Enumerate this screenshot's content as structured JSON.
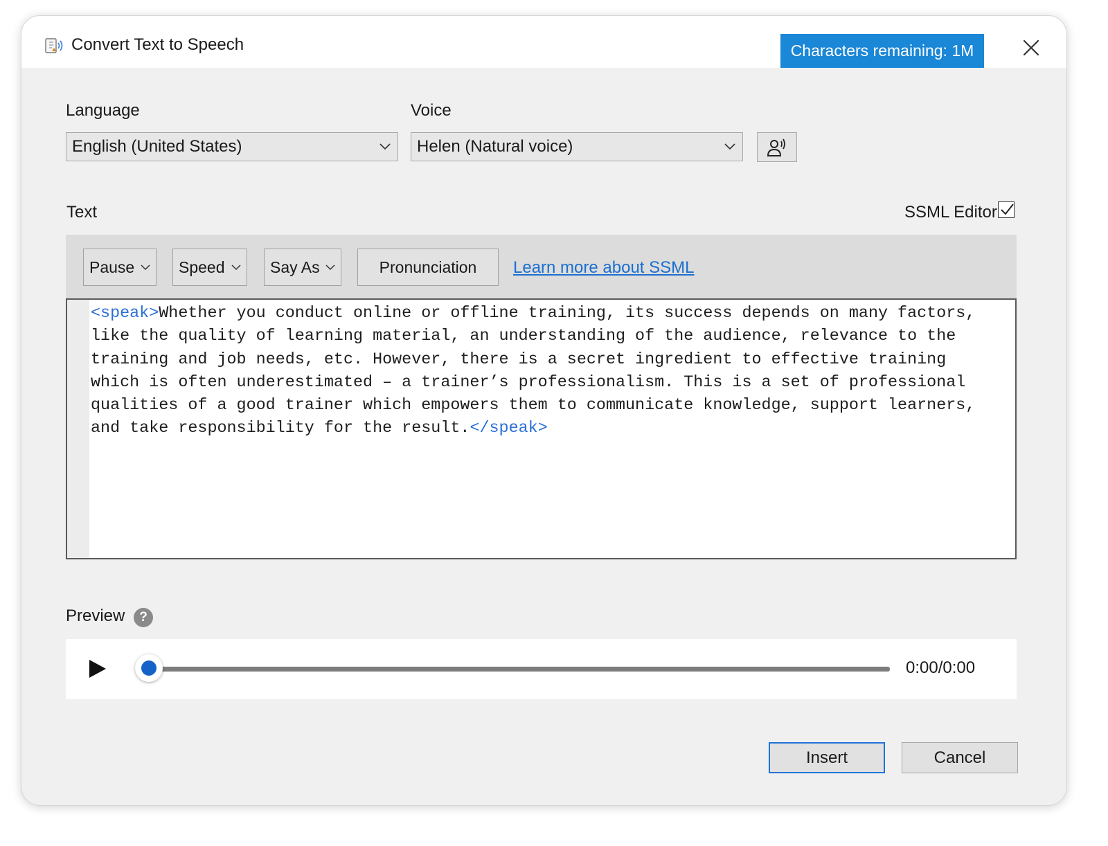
{
  "window": {
    "title": "Convert Text to Speech",
    "characters_remaining": "Characters remaining: 1M",
    "app_icon": "text-to-speech-icon",
    "close_icon": "close-icon"
  },
  "language": {
    "label": "Language",
    "selected": "English (United States)"
  },
  "voice": {
    "label": "Voice",
    "selected": "Helen (Natural voice)",
    "settings_icon": "voice-settings-icon"
  },
  "text_section": {
    "label": "Text",
    "ssml_editor_label": "SSML Editor",
    "ssml_editor_checked": true
  },
  "toolbar": {
    "pause": "Pause",
    "speed": "Speed",
    "say_as": "Say As",
    "pronunciation": "Pronunciation",
    "learn_more": "Learn more about SSML"
  },
  "editor": {
    "open_tag": "<speak>",
    "body": "Whether you conduct online or offline training, its success depends on many factors, like the quality of learning material, an understanding of the audience, relevance to the training and job needs, etc. However, there is a secret ingredient to effective training which is often underestimated – a trainer’s professionalism. This is a set of professional qualities of a good trainer which empowers them to communicate knowledge, support learners, and take responsibility for the result.",
    "close_tag": "</speak>"
  },
  "preview": {
    "label": "Preview",
    "help_icon": "?",
    "time": "0:00/0:00",
    "progress": 0
  },
  "buttons": {
    "insert": "Insert",
    "cancel": "Cancel"
  },
  "colors": {
    "accent": "#1a87d7",
    "link": "#1a6fcf",
    "tag": "#2a6fd6",
    "slider_thumb": "#1462c8"
  }
}
